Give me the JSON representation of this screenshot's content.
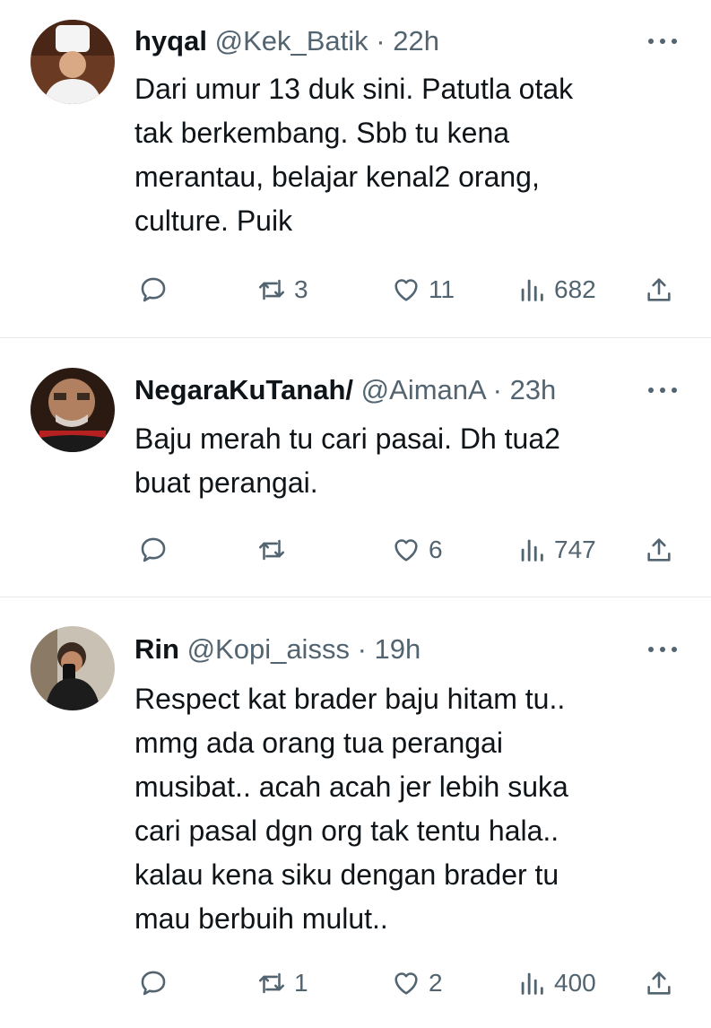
{
  "tweets": [
    {
      "name": "hyqal",
      "handle": "@Kek_Batik",
      "separator": "·",
      "time": "22h",
      "lines": [
        "Dari umur 13 duk sini. Patutla otak",
        "tak berkembang. Sbb tu kena",
        "merantau, belajar kenal2 orang,",
        "culture. Puik"
      ],
      "retweets": "3",
      "likes": "11",
      "views": "682"
    },
    {
      "name": "NegaraKuTanah/",
      "handle": "@AimanA",
      "separator": "·",
      "time": "23h",
      "lines": [
        "Baju merah tu cari pasai. Dh tua2",
        "buat perangai."
      ],
      "retweets": "",
      "likes": "6",
      "views": "747"
    },
    {
      "name": "Rin",
      "handle": "@Kopi_aisss",
      "separator": "·",
      "time": "19h",
      "lines": [
        "Respect kat brader baju hitam tu..",
        "mmg ada orang tua perangai",
        "musibat.. acah acah jer lebih suka",
        "cari pasal dgn org tak tentu hala..",
        "kalau kena siku dengan brader tu",
        "mau berbuih mulut.."
      ],
      "retweets": "1",
      "likes": "2",
      "views": "400"
    }
  ],
  "colors": {
    "text": "#0f1419",
    "secondary": "#536471",
    "divider": "#e6e9eb"
  },
  "icons": [
    "reply-icon",
    "retweet-icon",
    "like-icon",
    "views-icon",
    "share-icon",
    "more-icon"
  ]
}
